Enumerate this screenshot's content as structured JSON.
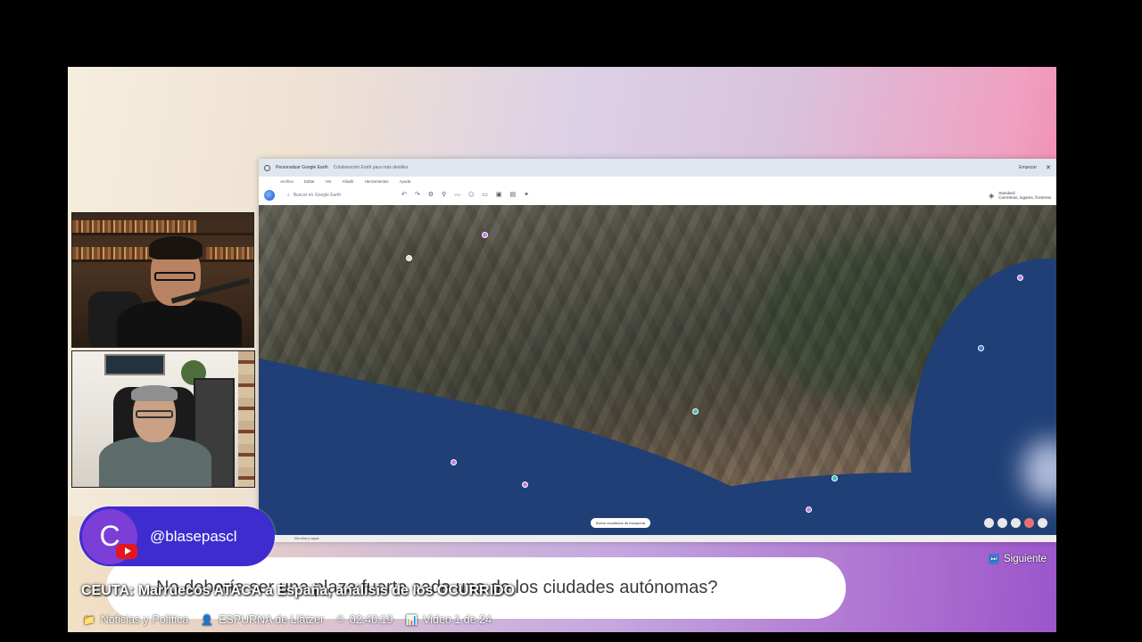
{
  "google_earth": {
    "window_title": "Personalizar Google Earth",
    "window_subtitle": "Colaboración Earth para más detalles",
    "title_right": "Empezar",
    "menu": [
      "Archivo",
      "Editar",
      "Ver",
      "Añadir",
      "Herramientas",
      "Ayuda"
    ],
    "search_placeholder": "Buscar en Google Earth",
    "style_label": "Standard",
    "style_sub": "Carreteras, lugares, fronteras",
    "status_text": "Mis sitios y capas",
    "map_pill": "Borrar resultados de búsqueda"
  },
  "channel": {
    "avatar_letter": "C",
    "handle": "@blasepascl"
  },
  "question": {
    "text": "No debería ser una plaza fuerte cada una de los ciudades autónomas?"
  },
  "video": {
    "title": "CEUTA: Marruecos ATACA a España, análisis de los OCURRIDO"
  },
  "meta": {
    "category_icon": "folder-icon",
    "category": "Noticias y Política",
    "channel_icon": "user-icon",
    "channel_name": "ESPURNA de Llàtzer",
    "duration_icon": "stopwatch-icon",
    "duration": "02:40:19",
    "position_icon": "chart-icon",
    "position": "Video 1 de 24"
  },
  "next": {
    "label": "Siguiente",
    "icon": "skip-forward-icon"
  }
}
